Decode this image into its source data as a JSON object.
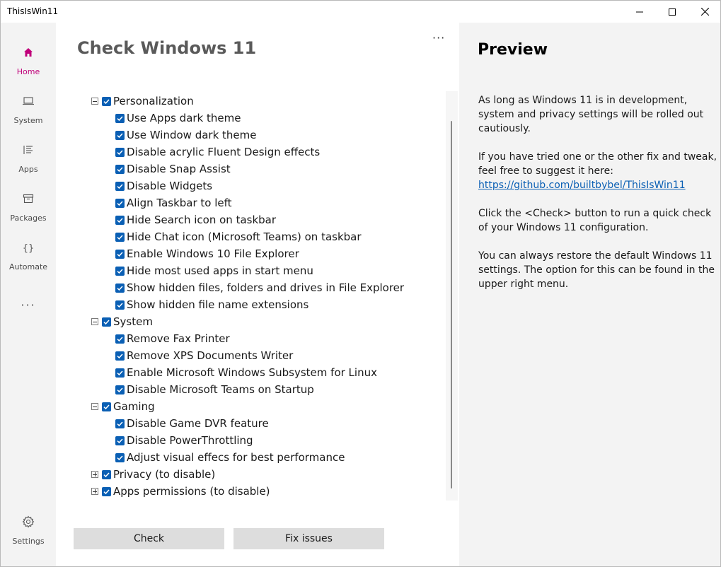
{
  "window": {
    "title": "ThisIsWin11"
  },
  "sidebar": {
    "items": [
      {
        "label": "Home",
        "icon": "home-icon",
        "active": true
      },
      {
        "label": "System",
        "icon": "laptop-icon",
        "active": false
      },
      {
        "label": "Apps",
        "icon": "list-icon",
        "active": false
      },
      {
        "label": "Packages",
        "icon": "archive-icon",
        "active": false
      },
      {
        "label": "Automate",
        "icon": "braces-icon",
        "active": false
      }
    ],
    "more": "···",
    "settings_label": "Settings"
  },
  "main": {
    "title": "Check Windows 11",
    "more": "···",
    "tree": [
      {
        "label": "Personalization",
        "expanded": true,
        "checked": true,
        "children": [
          "Use Apps dark theme",
          "Use Window dark theme",
          "Disable acrylic Fluent Design effects",
          "Disable Snap Assist",
          "Disable Widgets",
          "Align Taskbar to left",
          "Hide Search icon on taskbar",
          "Hide Chat icon (Microsoft Teams) on taskbar",
          "Enable Windows 10 File Explorer",
          "Hide most used apps in start menu",
          "Show hidden files, folders and drives in File Explorer",
          "Show hidden file name extensions"
        ]
      },
      {
        "label": "System",
        "expanded": true,
        "checked": true,
        "children": [
          "Remove Fax Printer",
          "Remove XPS Documents Writer",
          "Enable Microsoft Windows Subsystem for Linux",
          "Disable Microsoft Teams on Startup"
        ]
      },
      {
        "label": "Gaming",
        "expanded": true,
        "checked": true,
        "children": [
          "Disable Game DVR feature",
          "Disable PowerThrottling",
          "Adjust visual effecs for best performance"
        ]
      },
      {
        "label": "Privacy (to disable)",
        "expanded": false,
        "checked": true,
        "children": []
      },
      {
        "label": "Apps permissions (to disable)",
        "expanded": false,
        "checked": true,
        "children": []
      }
    ],
    "buttons": {
      "check": "Check",
      "fix": "Fix issues"
    }
  },
  "preview": {
    "title": "Preview",
    "p1": "As long as Windows 11 is in development, system and privacy settings will be rolled out cautiously.",
    "p2": "If you have tried one or the other fix and tweak, feel free to suggest it here:",
    "link": "https://github.com/builtbybel/ThisIsWin11",
    "p3": "Click the <Check> button to run a quick check of your Windows 11 configuration.",
    "p4": "You can always restore the default Windows 11 settings. The option for this can be found in the upper right menu."
  },
  "colors": {
    "accent": "#c0007a",
    "checkbox": "#0a5fb4",
    "sidebar_bg": "#f3f3f3",
    "button_bg": "#dddddd"
  }
}
